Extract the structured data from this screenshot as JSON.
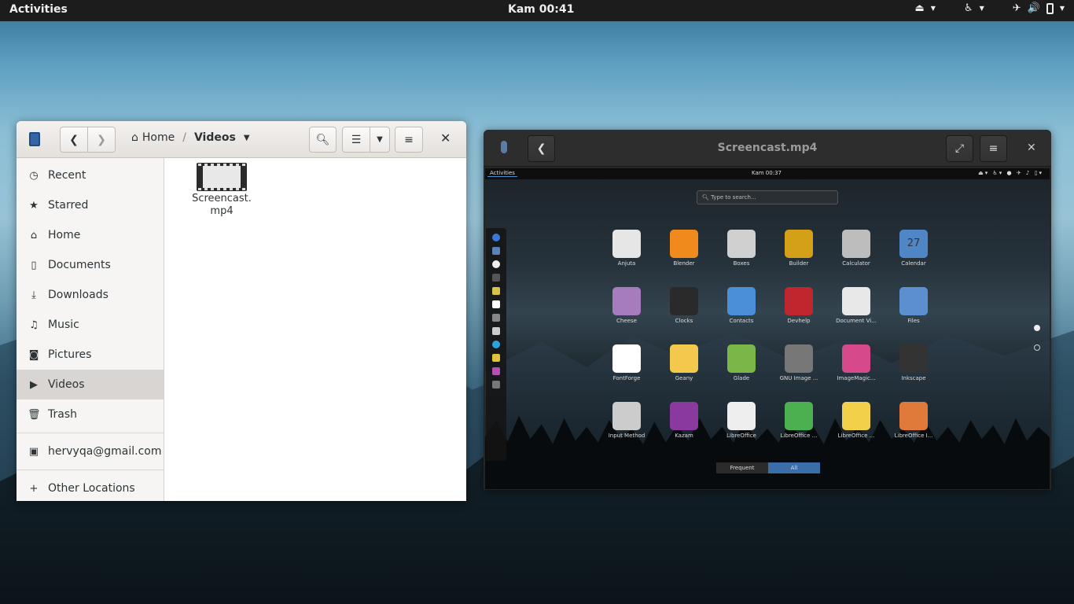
{
  "topbar": {
    "activities": "Activities",
    "clock": "Kam 00:41"
  },
  "nautilus": {
    "path_home": "Home",
    "path_current": "Videos",
    "sidebar": [
      {
        "label": "Recent",
        "icon": "clock-icon"
      },
      {
        "label": "Starred",
        "icon": "star-icon"
      },
      {
        "label": "Home",
        "icon": "home-icon"
      },
      {
        "label": "Documents",
        "icon": "document-icon"
      },
      {
        "label": "Downloads",
        "icon": "download-icon"
      },
      {
        "label": "Music",
        "icon": "music-icon"
      },
      {
        "label": "Pictures",
        "icon": "camera-icon"
      },
      {
        "label": "Videos",
        "icon": "video-icon",
        "selected": true
      },
      {
        "label": "Trash",
        "icon": "trash-icon"
      }
    ],
    "account": "hervyqa@gmail.com",
    "other_locations": "Other Locations",
    "file": {
      "line1": "Screencast.",
      "line2": "mp4"
    }
  },
  "video_window": {
    "title": "Screencast.mp4",
    "inner": {
      "activities": "Activities",
      "clock": "Kam 00:37",
      "search_placeholder": "Type to search...",
      "apps": [
        "Anjuta",
        "Blender",
        "Boxes",
        "Builder",
        "Calculator",
        "Calendar",
        "Cheese",
        "Clocks",
        "Contacts",
        "Devhelp",
        "Document Vi...",
        "Files",
        "FontForge",
        "Geany",
        "Glade",
        "GNU Image ...",
        "ImageMagic...",
        "Inkscape",
        "Input Method",
        "Kazam",
        "LibreOffice",
        "LibreOffice ...",
        "LibreOffice ...",
        "LibreOffice I..."
      ],
      "calendar_day": "27",
      "tab_frequent": "Frequent",
      "tab_all": "All"
    }
  },
  "colors": {
    "accent": "#4a90d9",
    "topbar": "#1c1c1c"
  }
}
